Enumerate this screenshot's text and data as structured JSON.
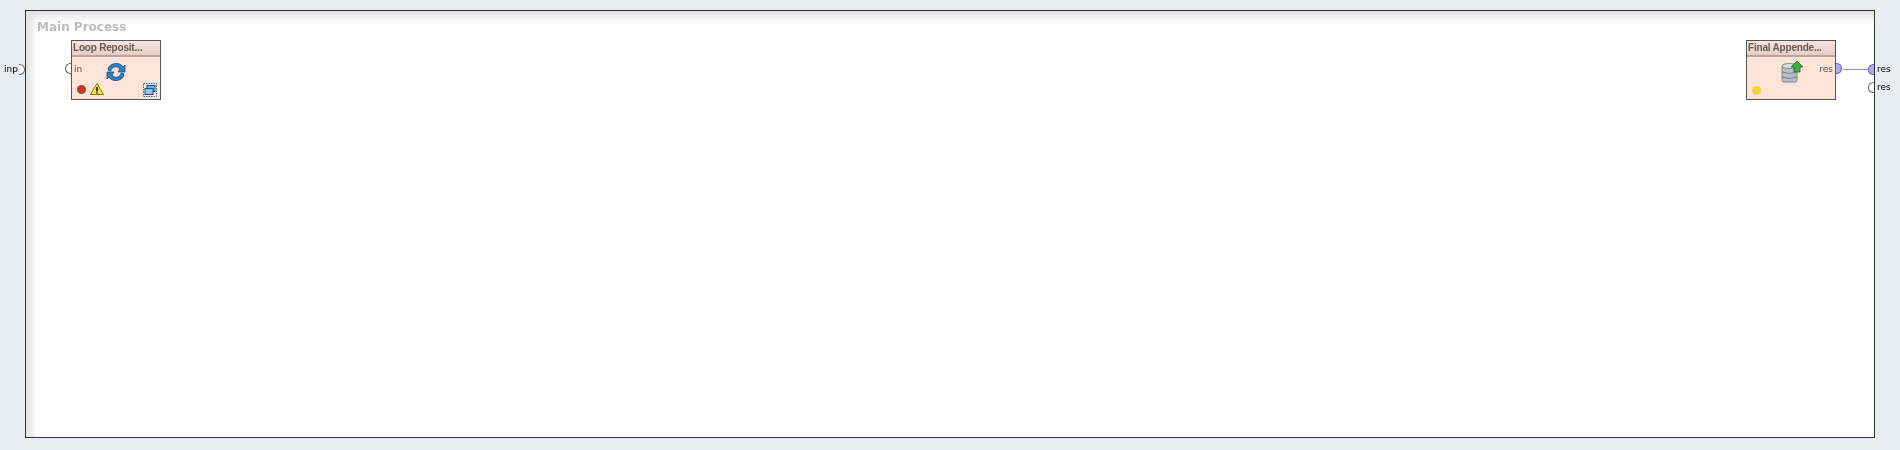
{
  "process": {
    "title": "Main Process"
  },
  "inputs": [
    {
      "label": "inp",
      "connected": false
    }
  ],
  "outputs": [
    {
      "label": "res",
      "connected": true
    },
    {
      "label": "res",
      "connected": false
    }
  ],
  "operators": [
    {
      "title": "Loop Reposit...",
      "kind": "loop",
      "ports_in": [
        {
          "label": "in",
          "connected": false
        }
      ],
      "color": "#c0392b",
      "warning": true,
      "subprocess": true
    },
    {
      "title": "Final Appende...",
      "kind": "store",
      "ports_out": [
        {
          "label": "res",
          "connected": true
        }
      ],
      "color": "#f2d43a",
      "warning": false,
      "subprocess": false
    }
  ]
}
